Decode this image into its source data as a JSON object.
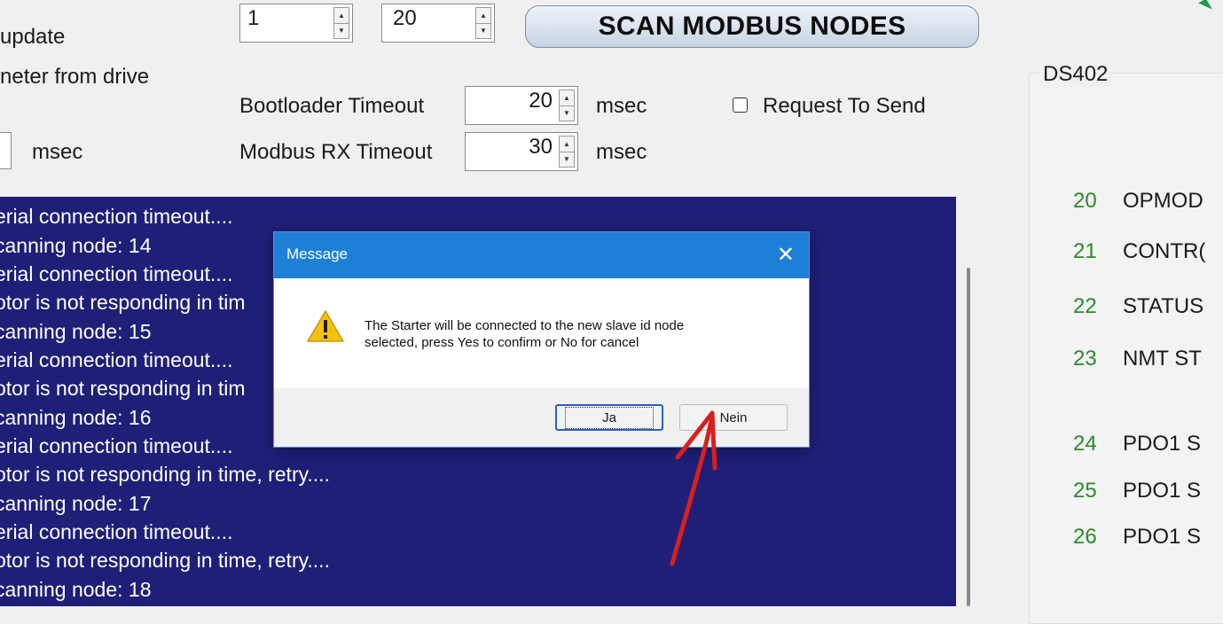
{
  "top_controls": {
    "update_label": "update",
    "from_drive_label": "neter from drive",
    "spinner1_value": "1",
    "spinner2_value": "20",
    "scan_button": "SCAN MODBUS NODES",
    "bootloader_label": "Bootloader Timeout",
    "bootloader_value": "20",
    "bootloader_unit": "msec",
    "modbus_label": "Modbus RX Timeout",
    "modbus_value": "30",
    "modbus_unit": "msec",
    "left_unit": "msec",
    "rts_label": "Request To Send",
    "rts_checked": false
  },
  "log_lines": [
    "erial connection timeout....",
    "canning node: 14",
    "erial connection timeout....",
    "otor is not responding in tim",
    "canning node: 15",
    "erial connection timeout....",
    "otor is not responding in tim",
    "canning node: 16",
    "erial connection timeout....",
    "otor is not responding in time, retry....",
    "canning node: 17",
    "erial connection timeout....",
    "otor is not responding in time, retry....",
    "canning node: 18"
  ],
  "ds402": {
    "title": "DS402",
    "rows": [
      {
        "num": "20",
        "name": "OPMOD"
      },
      {
        "num": "21",
        "name": "CONTR("
      },
      {
        "num": "22",
        "name": "STATUS"
      },
      {
        "num": "23",
        "name": "NMT ST"
      },
      {
        "num": "24",
        "name": "PDO1 S"
      },
      {
        "num": "25",
        "name": "PDO1 S"
      },
      {
        "num": "26",
        "name": "PDO1 S"
      }
    ]
  },
  "dialog": {
    "title": "Message",
    "message_line1": "The Starter will be connected to the new slave id node",
    "message_line2": "selected, press Yes to confirm or No for cancel",
    "yes_button": "Ja",
    "no_button": "Nein",
    "icon": "warning-icon"
  },
  "colors": {
    "log_background": "#1f1f78",
    "dialog_title_bar": "#1e7fd7",
    "ds_number_green": "#2a8a2a",
    "annotation_arrow": "#d62020"
  }
}
